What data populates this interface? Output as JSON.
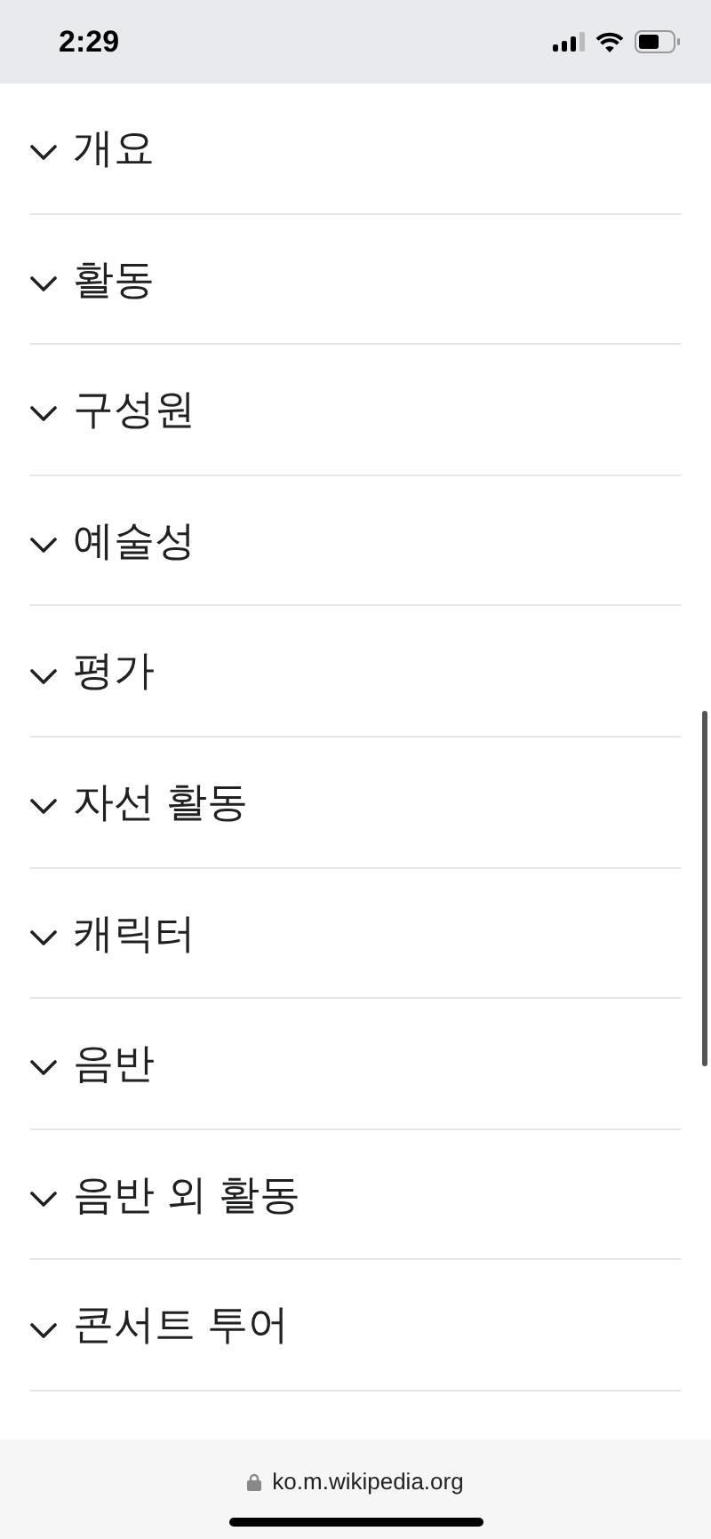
{
  "status_bar": {
    "time": "2:29"
  },
  "sections": [
    {
      "title": "개요",
      "expanded": false
    },
    {
      "title": "활동",
      "expanded": false
    },
    {
      "title": "구성원",
      "expanded": false
    },
    {
      "title": "예술성",
      "expanded": false
    },
    {
      "title": "평가",
      "expanded": false
    },
    {
      "title": "자선 활동",
      "expanded": false
    },
    {
      "title": "캐릭터",
      "expanded": false
    },
    {
      "title": "음반",
      "expanded": false
    },
    {
      "title": "음반 외 활동",
      "expanded": false
    },
    {
      "title": "콘서트 투어",
      "expanded": false
    }
  ],
  "address_bar": {
    "url": "ko.m.wikipedia.org"
  }
}
